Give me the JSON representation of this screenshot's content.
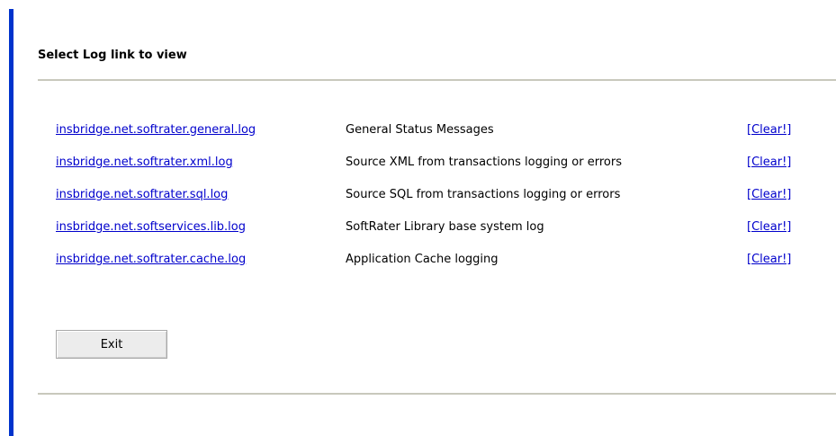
{
  "heading": "Select Log link to view",
  "logs": [
    {
      "file": "insbridge.net.softrater.general.log",
      "description": "General Status Messages",
      "clear": "[Clear!]"
    },
    {
      "file": "insbridge.net.softrater.xml.log",
      "description": "Source XML from transactions logging or errors",
      "clear": "[Clear!]"
    },
    {
      "file": "insbridge.net.softrater.sql.log",
      "description": "Source SQL from transactions logging or errors",
      "clear": "[Clear!]"
    },
    {
      "file": "insbridge.net.softservices.lib.log",
      "description": "SoftRater Library base system log",
      "clear": "[Clear!]"
    },
    {
      "file": "insbridge.net.softrater.cache.log",
      "description": "Application Cache logging",
      "clear": "[Clear!]"
    }
  ],
  "exit_label": "Exit",
  "colors": {
    "accent_bar": "#0033cc",
    "link": "#0000cc",
    "rule": "#c8c8bc"
  }
}
